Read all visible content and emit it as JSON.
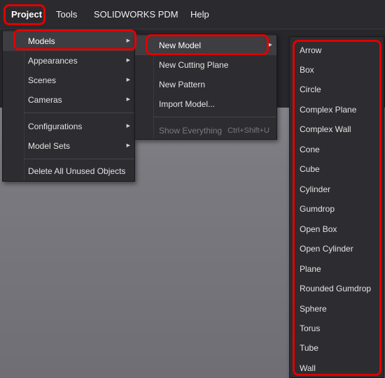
{
  "menubar": {
    "items": [
      "Project",
      "Tools",
      "SOLIDWORKS PDM",
      "Help"
    ]
  },
  "project_menu": {
    "models": "Models",
    "appearances": "Appearances",
    "scenes": "Scenes",
    "cameras": "Cameras",
    "configurations": "Configurations",
    "model_sets": "Model Sets",
    "delete_unused": "Delete All Unused Objects"
  },
  "models_menu": {
    "new_model": "New Model",
    "new_cutting_plane": "New Cutting Plane",
    "new_pattern": "New Pattern",
    "import_model": "Import Model...",
    "show_everything": "Show Everything",
    "show_everything_shortcut": "Ctrl+Shift+U"
  },
  "new_model_menu": {
    "items": [
      "Arrow",
      "Box",
      "Circle",
      "Complex Plane",
      "Complex Wall",
      "Cone",
      "Cube",
      "Cylinder",
      "Gumdrop",
      "Open Box",
      "Open Cylinder",
      "Plane",
      "Rounded Gumdrop",
      "Sphere",
      "Torus",
      "Tube",
      "Wall"
    ]
  },
  "icons": {
    "submenu_arrow": "chevron-right-icon"
  },
  "colors": {
    "highlight_outline": "#e00000",
    "menu_background": "#2d2d31",
    "menubar_background": "#2b2b2f"
  }
}
